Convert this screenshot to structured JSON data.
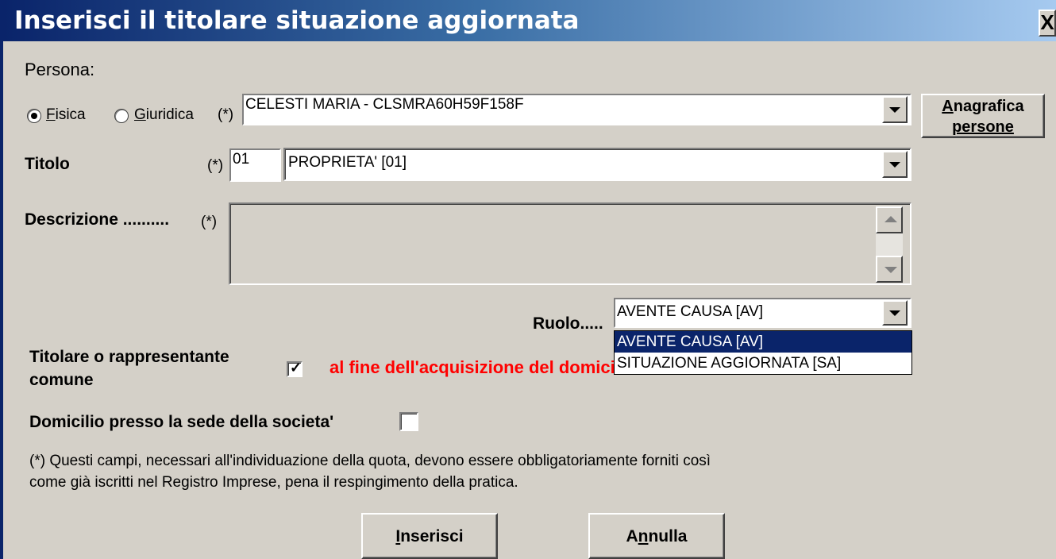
{
  "window": {
    "title": "Inserisci il titolare situazione aggiornata",
    "close_glyph": "X"
  },
  "persona": {
    "heading": "Persona:",
    "radio_fisica": {
      "hotkey": "F",
      "rest": "isica",
      "selected": true
    },
    "radio_giuridica": {
      "hotkey": "G",
      "rest": "iuridica",
      "selected": false
    },
    "required_mark": "(*)",
    "value": "CELESTI MARIA - CLSMRA60H59F158F"
  },
  "anagrafica_button": {
    "hotkey": "A",
    "rest": "nagrafica",
    "line2": "persone"
  },
  "titolo": {
    "label": "Titolo",
    "required_mark": "(*)",
    "code": "01",
    "value": "PROPRIETA' [01]"
  },
  "descrizione": {
    "label": "Descrizione ..........",
    "required_mark": "(*)",
    "value": ""
  },
  "ruolo": {
    "label": "Ruolo.....",
    "value": "AVENTE CAUSA [AV]",
    "options": [
      "AVENTE CAUSA [AV]",
      "SITUAZIONE AGGIORNATA [SA]"
    ],
    "selected_index": 0
  },
  "titolare": {
    "label_line1": "Titolare o rappresentante",
    "label_line2": "comune",
    "checked": true,
    "note": "al fine dell'acquisizione del domicilio",
    "note_color": "#ff0000"
  },
  "domicilio": {
    "label": "Domicilio presso la sede della societa'",
    "checked": false
  },
  "footnote": {
    "line1": "(*) Questi campi, necessari all'individuazione della quota, devono essere obbligatoriamente forniti così",
    "line2": "come già iscritti nel Registro Imprese, pena il respingimento della pratica."
  },
  "buttons": {
    "inserisci": {
      "hotkey": "I",
      "rest": "nserisci"
    },
    "annulla": {
      "pre": "A",
      "hotkey": "n",
      "rest": "nulla"
    }
  },
  "colors": {
    "title_gradient_start": "#0a246a",
    "title_gradient_end": "#a6caf0",
    "dialog_bg": "#d4d0c8",
    "selection": "#0a246a"
  },
  "icons": {
    "dropdown": "triangle-down",
    "scroll_up": "triangle-up",
    "scroll_down": "triangle-down",
    "check": "✓"
  }
}
